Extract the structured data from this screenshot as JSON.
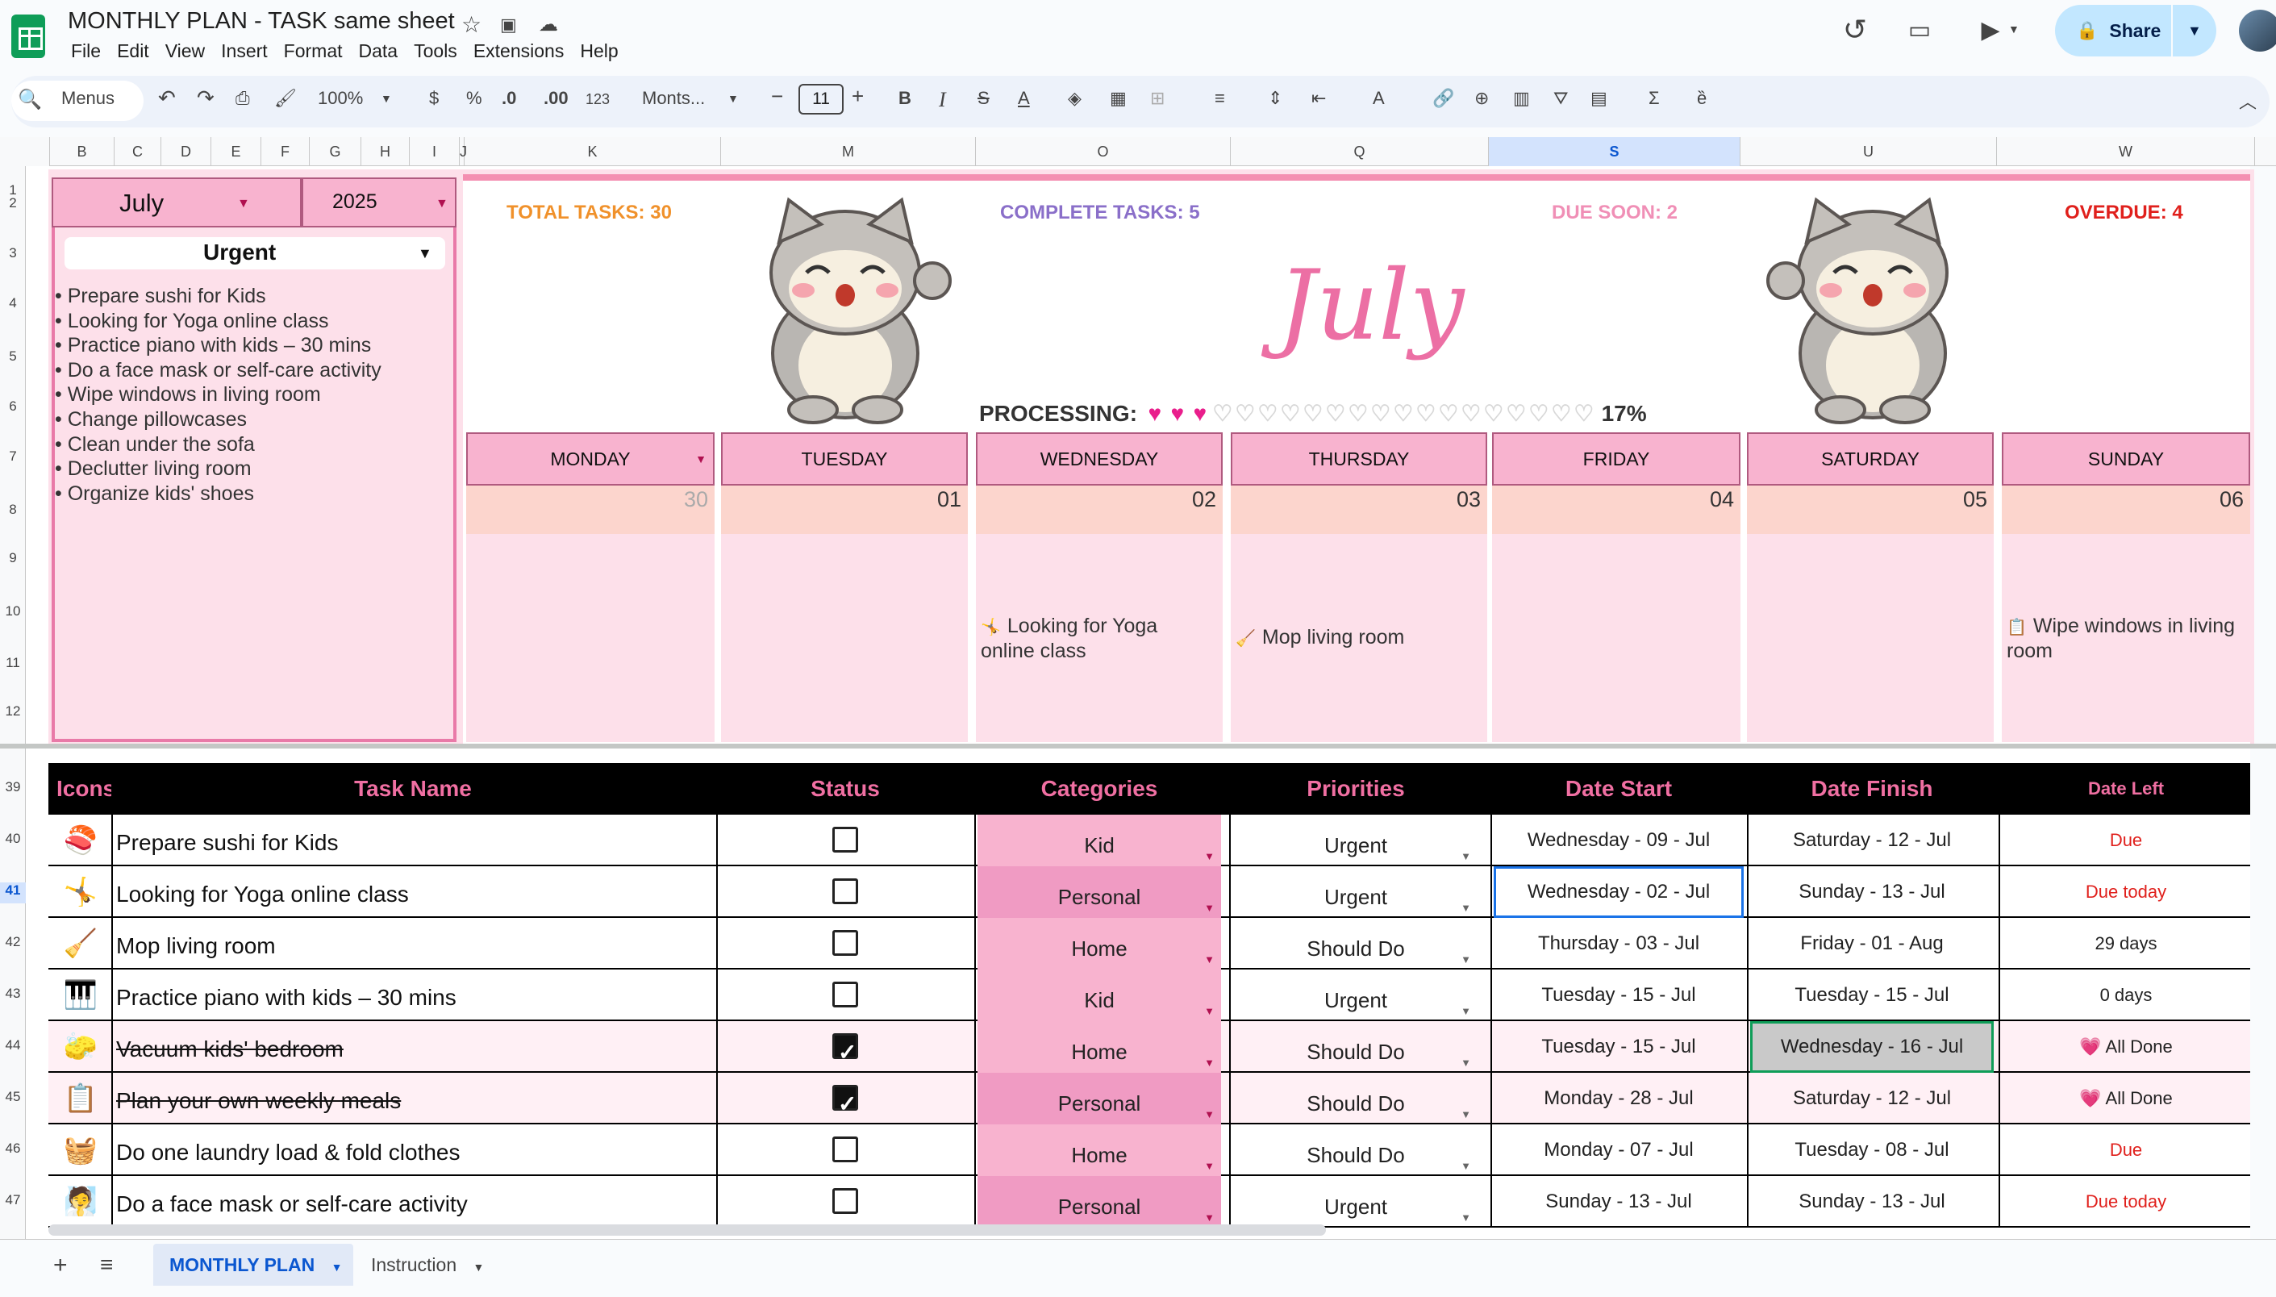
{
  "app": {
    "doc_title": "MONTHLY PLAN - TASK same sheet",
    "menu": [
      "File",
      "Edit",
      "View",
      "Insert",
      "Format",
      "Data",
      "Tools",
      "Extensions",
      "Help"
    ],
    "share_label": "Share"
  },
  "toolbar": {
    "search_label": "Menus",
    "zoom": "100%",
    "currency": "$",
    "percent": "%",
    "dec_less": ".0",
    "dec_more": ".00",
    "number_format": "123",
    "font": "Monts...",
    "font_size": "11"
  },
  "columns": [
    "B",
    "C",
    "D",
    "E",
    "F",
    "G",
    "H",
    "I",
    "J",
    "K",
    "M",
    "O",
    "Q",
    "S",
    "U",
    "W"
  ],
  "rows_top": [
    "1",
    "2",
    "3",
    "4",
    "5",
    "6",
    "7",
    "8",
    "9",
    "10",
    "11",
    "12"
  ],
  "rows_bottom": [
    "39",
    "40",
    "41",
    "42",
    "43",
    "44",
    "45",
    "46",
    "47"
  ],
  "left_panel": {
    "month": "July",
    "year": "2025",
    "filter": "Urgent",
    "urgent_tasks": [
      "• Prepare sushi for Kids",
      "• Looking for Yoga online class",
      "• Practice piano with kids – 30 mins",
      "• Do a face mask or self-care activity",
      "• Wipe windows in living room",
      "• Change pillowcases",
      "• Clean under the sofa",
      "• Declutter living room",
      "• Organize kids' shoes"
    ]
  },
  "stats": {
    "total": "TOTAL TASKS: 30",
    "complete": "COMPLETE TASKS: 5",
    "due_soon": "DUE SOON: 2",
    "overdue": "OVERDUE: 4",
    "total_color": "#f0912b",
    "complete_color": "#8a6fc9",
    "due_soon_color": "#f08fb6",
    "overdue_color": "#e0201c"
  },
  "calendar": {
    "big_month": "July",
    "processing_label": "PROCESSING:",
    "processing_percent": "17%",
    "progress_fraction": 0.17,
    "hearts_filled": 3,
    "hearts_total": 20,
    "days": [
      "MONDAY",
      "TUESDAY",
      "WEDNESDAY",
      "THURSDAY",
      "FRIDAY",
      "SATURDAY",
      "SUNDAY"
    ],
    "dates": [
      "30",
      "01",
      "02",
      "03",
      "04",
      "05",
      "06"
    ],
    "tasks": {
      "wednesday": "Looking for Yoga online class",
      "thursday": "Mop living room",
      "sunday": "Wipe windows in living room"
    }
  },
  "table": {
    "headers": [
      "Icons",
      "Task Name",
      "Status",
      "Categories",
      "Priorities",
      "Date Start",
      "Date Finish",
      "Date Left"
    ],
    "rows": [
      {
        "icon": "🍣",
        "name": "Prepare sushi for Kids",
        "done": false,
        "category": "Kid",
        "priority": "Urgent",
        "start": "Wednesday - 09 - Jul",
        "finish": "Saturday - 12 - Jul",
        "left": "Due"
      },
      {
        "icon": "🤸",
        "name": "Looking for Yoga online class",
        "done": false,
        "category": "Personal",
        "priority": "Urgent",
        "start": "Wednesday - 02 - Jul",
        "finish": "Sunday - 13 - Jul",
        "left": "Due today"
      },
      {
        "icon": "🧹",
        "name": "Mop living room",
        "done": false,
        "category": "Home",
        "priority": "Should Do",
        "start": "Thursday - 03 - Jul",
        "finish": "Friday - 01 - Aug",
        "left": "29 days"
      },
      {
        "icon": "🎹",
        "name": "Practice piano with kids – 30 mins",
        "done": false,
        "category": "Kid",
        "priority": "Urgent",
        "start": "Tuesday - 15 - Jul",
        "finish": "Tuesday - 15 - Jul",
        "left": "0 days"
      },
      {
        "icon": "🧽",
        "name": "Vacuum kids' bedroom",
        "done": true,
        "category": "Home",
        "priority": "Should Do",
        "start": "Tuesday - 15 - Jul",
        "finish": "Wednesday - 16 - Jul",
        "left": "💗 All Done"
      },
      {
        "icon": "📋",
        "name": "Plan your own weekly meals",
        "done": true,
        "category": "Personal",
        "priority": "Should Do",
        "start": "Monday - 28 - Jul",
        "finish": "Saturday - 12 - Jul",
        "left": "💗 All Done"
      },
      {
        "icon": "🧺",
        "name": "Do one laundry load & fold clothes",
        "done": false,
        "category": "Home",
        "priority": "Should Do",
        "start": "Monday - 07 - Jul",
        "finish": "Tuesday - 08 - Jul",
        "left": "Due"
      },
      {
        "icon": "🧖",
        "name": "Do a face mask or self-care activity",
        "done": false,
        "category": "Personal",
        "priority": "Urgent",
        "start": "Sunday - 13 - Jul",
        "finish": "Sunday - 13 - Jul",
        "left": "Due today"
      }
    ]
  },
  "tabs": {
    "active": "MONTHLY PLAN",
    "other": "Instruction"
  }
}
